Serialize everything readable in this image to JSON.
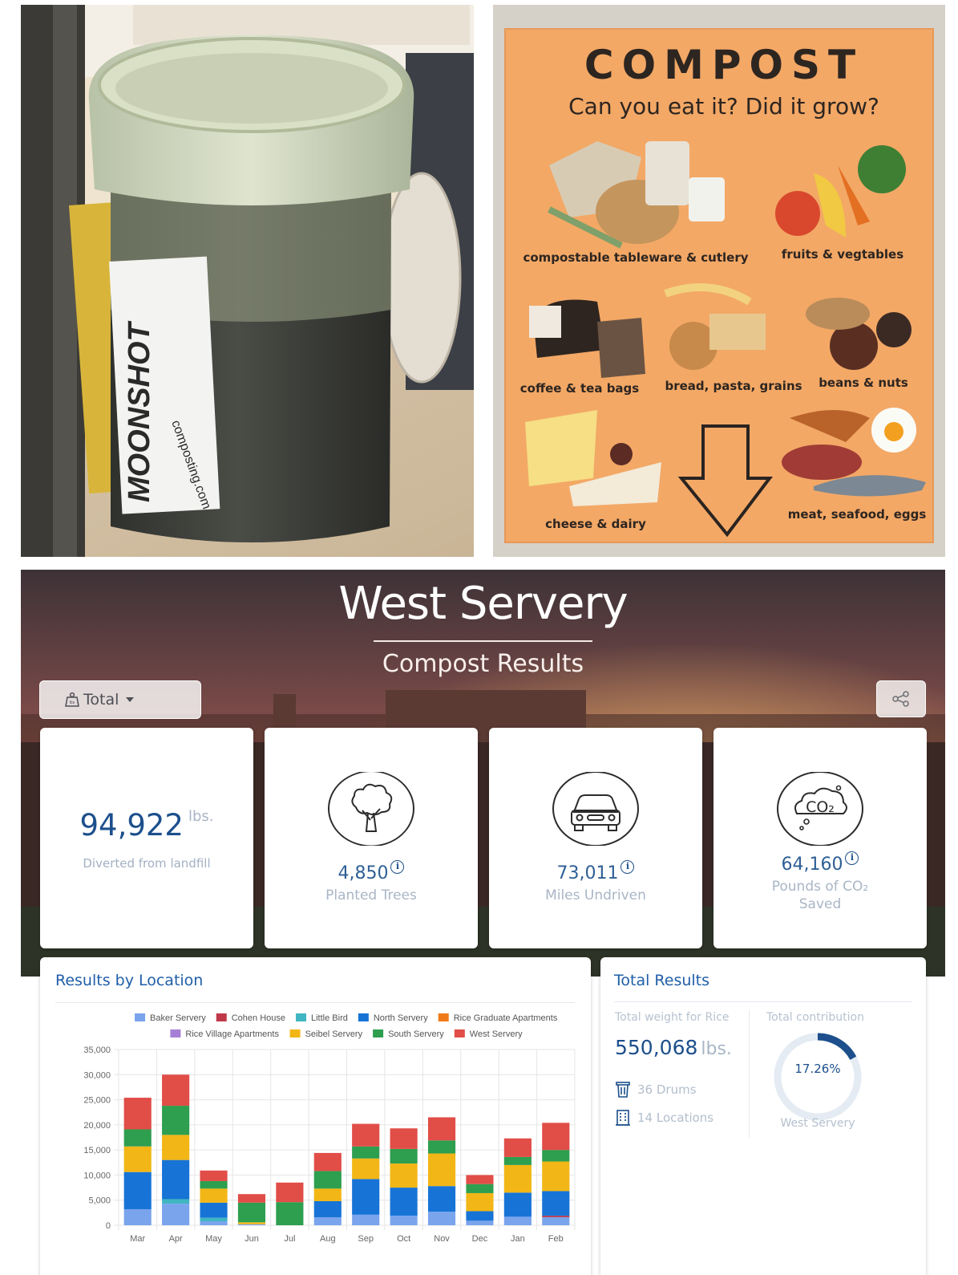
{
  "photos": {
    "bin": {
      "label_brand": "MOONSHOT",
      "label_url": "composting.com"
    },
    "poster": {
      "title": "COMPOST",
      "subtitle": "Can you eat it? Did it grow?",
      "categories": [
        "compostable tableware & cutlery",
        "fruits & vegtables",
        "coffee & tea bags",
        "bread, pasta, grains",
        "beans & nuts",
        "cheese & dairy",
        "meat, seafood, eggs"
      ],
      "colors": {
        "background": "#f3a866"
      }
    }
  },
  "dashboard": {
    "title": "West Servery",
    "subtitle": "Compost Results",
    "dropdown": {
      "label": "Total",
      "icon": "scale-icon"
    },
    "share": {
      "icon": "share-icon"
    },
    "cards": {
      "landfill": {
        "value": "94,922",
        "unit": "lbs.",
        "caption": "Diverted from landfill"
      },
      "trees": {
        "value": "4,850",
        "label": "Planted Trees",
        "icon": "tree-icon",
        "info": "i"
      },
      "miles": {
        "value": "73,011",
        "label": "Miles Undriven",
        "icon": "car-icon",
        "info": "i"
      },
      "co2": {
        "value": "64,160",
        "label_line1": "Pounds of CO₂",
        "label_line2": "Saved",
        "icon": "co2-cloud-icon",
        "icon_text": "CO₂",
        "info": "i"
      }
    },
    "location_panel": {
      "title": "Results by Location"
    },
    "total_panel": {
      "title": "Total Results",
      "weight_label": "Total weight for Rice",
      "weight_value": "550,068",
      "weight_unit": "lbs.",
      "drums": "36 Drums",
      "locations": "14 Locations",
      "contribution_label": "Total contribution",
      "contribution_value": "17.26%",
      "contribution_fraction": 0.1726,
      "contribution_caption": "West Servery"
    },
    "colors": {
      "accent": "#1c4f8c",
      "title_blue": "#1f5ea8"
    }
  },
  "chart_data": {
    "type": "bar",
    "stacked": true,
    "categories": [
      "Mar",
      "Apr",
      "May",
      "Jun",
      "Jul",
      "Aug",
      "Sep",
      "Oct",
      "Nov",
      "Dec",
      "Jan",
      "Feb"
    ],
    "ylim": [
      0,
      35000
    ],
    "yticks": [
      "0",
      "5,000",
      "10,000",
      "15,000",
      "20,000",
      "25,000",
      "30,000",
      "35,000"
    ],
    "grid": true,
    "legend_position": "top",
    "series": [
      {
        "name": "Baker Servery",
        "color": "#7aa4ec",
        "values": [
          3200,
          4300,
          800,
          200,
          0,
          1600,
          2100,
          1900,
          2700,
          900,
          1700,
          1600
        ]
      },
      {
        "name": "Cohen House",
        "color": "#c0394b",
        "values": [
          0,
          0,
          0,
          0,
          0,
          0,
          0,
          0,
          0,
          0,
          0,
          300
        ]
      },
      {
        "name": "Little Bird",
        "color": "#3fb6c2",
        "values": [
          0,
          900,
          700,
          0,
          0,
          0,
          0,
          0,
          0,
          0,
          0,
          0
        ]
      },
      {
        "name": "North Servery",
        "color": "#1774d6",
        "values": [
          7400,
          7800,
          3000,
          0,
          0,
          3200,
          7100,
          5600,
          5100,
          1900,
          4800,
          4900
        ]
      },
      {
        "name": "Rice Graduate Apartments",
        "color": "#f07a1a",
        "values": [
          0,
          0,
          0,
          0,
          0,
          0,
          0,
          0,
          0,
          0,
          0,
          0
        ]
      },
      {
        "name": "Rice Village Apartments",
        "color": "#a67fd6",
        "values": [
          0,
          0,
          0,
          0,
          0,
          0,
          0,
          0,
          0,
          0,
          0,
          0
        ]
      },
      {
        "name": "Seibel Servery",
        "color": "#f2b616",
        "values": [
          5100,
          5000,
          2800,
          400,
          0,
          2500,
          4100,
          4800,
          6500,
          3600,
          5500,
          5900
        ]
      },
      {
        "name": "South Servery",
        "color": "#2e9e4f",
        "values": [
          3400,
          5800,
          1500,
          3900,
          4600,
          3500,
          2400,
          2900,
          2600,
          1800,
          1600,
          2300
        ]
      },
      {
        "name": "West Servery",
        "color": "#e14d47",
        "values": [
          6300,
          6200,
          2100,
          1700,
          3900,
          3600,
          4500,
          4100,
          4600,
          1800,
          3700,
          5400
        ]
      }
    ]
  }
}
